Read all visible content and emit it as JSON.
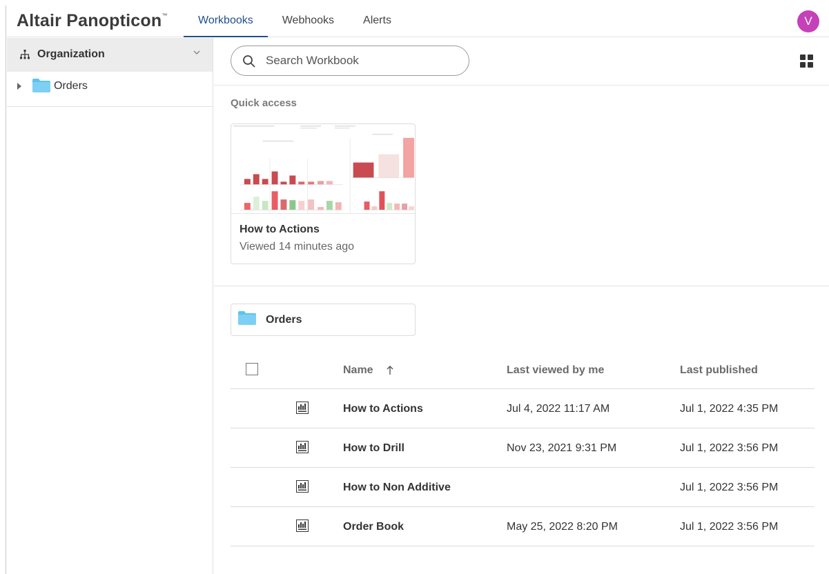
{
  "header": {
    "brand": "Altair Panopticon",
    "brand_mark": "™",
    "tabs": [
      {
        "label": "Workbooks",
        "active": true
      },
      {
        "label": "Webhooks",
        "active": false
      },
      {
        "label": "Alerts",
        "active": false
      }
    ],
    "avatar_letter": "V",
    "avatar_color": "#c640b8",
    "accent_color": "#1f4f8a"
  },
  "sidebar": {
    "org_label": "Organization",
    "org_icon": "hierarchy-icon",
    "tree": [
      {
        "label": "Orders",
        "icon": "folder-icon",
        "expanded": false
      }
    ]
  },
  "main": {
    "search_placeholder": "Search Workbook",
    "view_toggle_icon": "grid-view-icon",
    "quick_access_title": "Quick access",
    "quick_access": [
      {
        "title": "How to Actions",
        "subtitle": "Viewed 14 minutes ago"
      }
    ],
    "folders": [
      {
        "label": "Orders",
        "icon": "folder-icon",
        "folder_color": "#5cc3f0"
      }
    ],
    "table": {
      "columns": [
        "Name",
        "Last viewed by me",
        "Last published"
      ],
      "sort_column": "Name",
      "sort_direction": "ascending",
      "rows": [
        {
          "name": "How to Actions",
          "last_viewed": "Jul 4, 2022 11:17 AM",
          "last_published": "Jul 1, 2022 4:35 PM"
        },
        {
          "name": "How to Drill",
          "last_viewed": "Nov 23, 2021 9:31 PM",
          "last_published": "Jul 1, 2022 3:56 PM"
        },
        {
          "name": "How to Non Additive",
          "last_viewed": "",
          "last_published": "Jul 1, 2022 3:56 PM"
        },
        {
          "name": "Order Book",
          "last_viewed": "May 25, 2022 8:20 PM",
          "last_published": "Jul 1, 2022 3:56 PM"
        }
      ]
    }
  }
}
